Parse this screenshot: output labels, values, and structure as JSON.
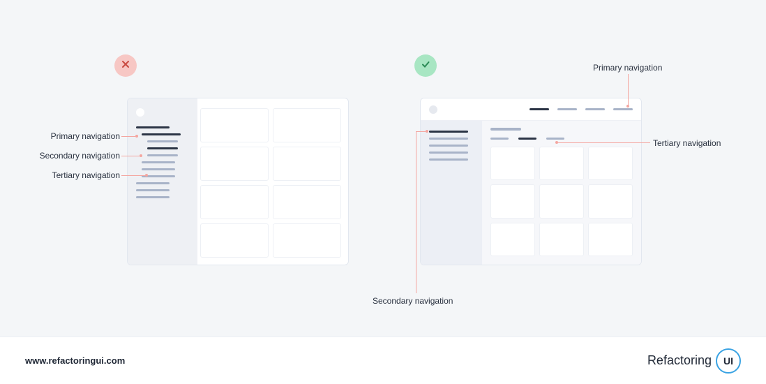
{
  "labels": {
    "primary": "Primary navigation",
    "secondary": "Secondary navigation",
    "tertiary": "Tertiary navigation"
  },
  "footer": {
    "url": "www.refactoringui.com",
    "brand_left": "Refactoring",
    "brand_right": "UI"
  },
  "status_icons": {
    "bad": "cross-icon",
    "good": "check-icon"
  },
  "colors": {
    "accent_pointer": "#f4a6a0",
    "nav_dark": "#2b3445",
    "nav_light": "#a8b3c8",
    "badge_bad": "#f7c7c4",
    "badge_good": "#a8e6c3",
    "logo_ring": "#3aa3e3"
  }
}
